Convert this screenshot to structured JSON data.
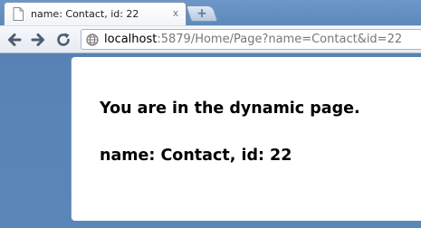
{
  "browser": {
    "tab": {
      "title": "name: Contact, id: 22",
      "close_glyph": "x"
    },
    "new_tab_glyph": "+",
    "address_bar": {
      "host": "localhost",
      "rest": ":5879/Home/Page?name=Contact&id=22"
    },
    "icons": {
      "tab_favicon": "page-icon",
      "back": "arrow-left-icon",
      "forward": "arrow-right-icon",
      "reload": "reload-icon",
      "site": "globe-icon"
    }
  },
  "page": {
    "line1": "You are in the dynamic page.",
    "line2": "name: Contact, id: 22"
  },
  "colors": {
    "frame": "#5a86b8",
    "page_background": "#ffffff",
    "text": "#000000"
  }
}
